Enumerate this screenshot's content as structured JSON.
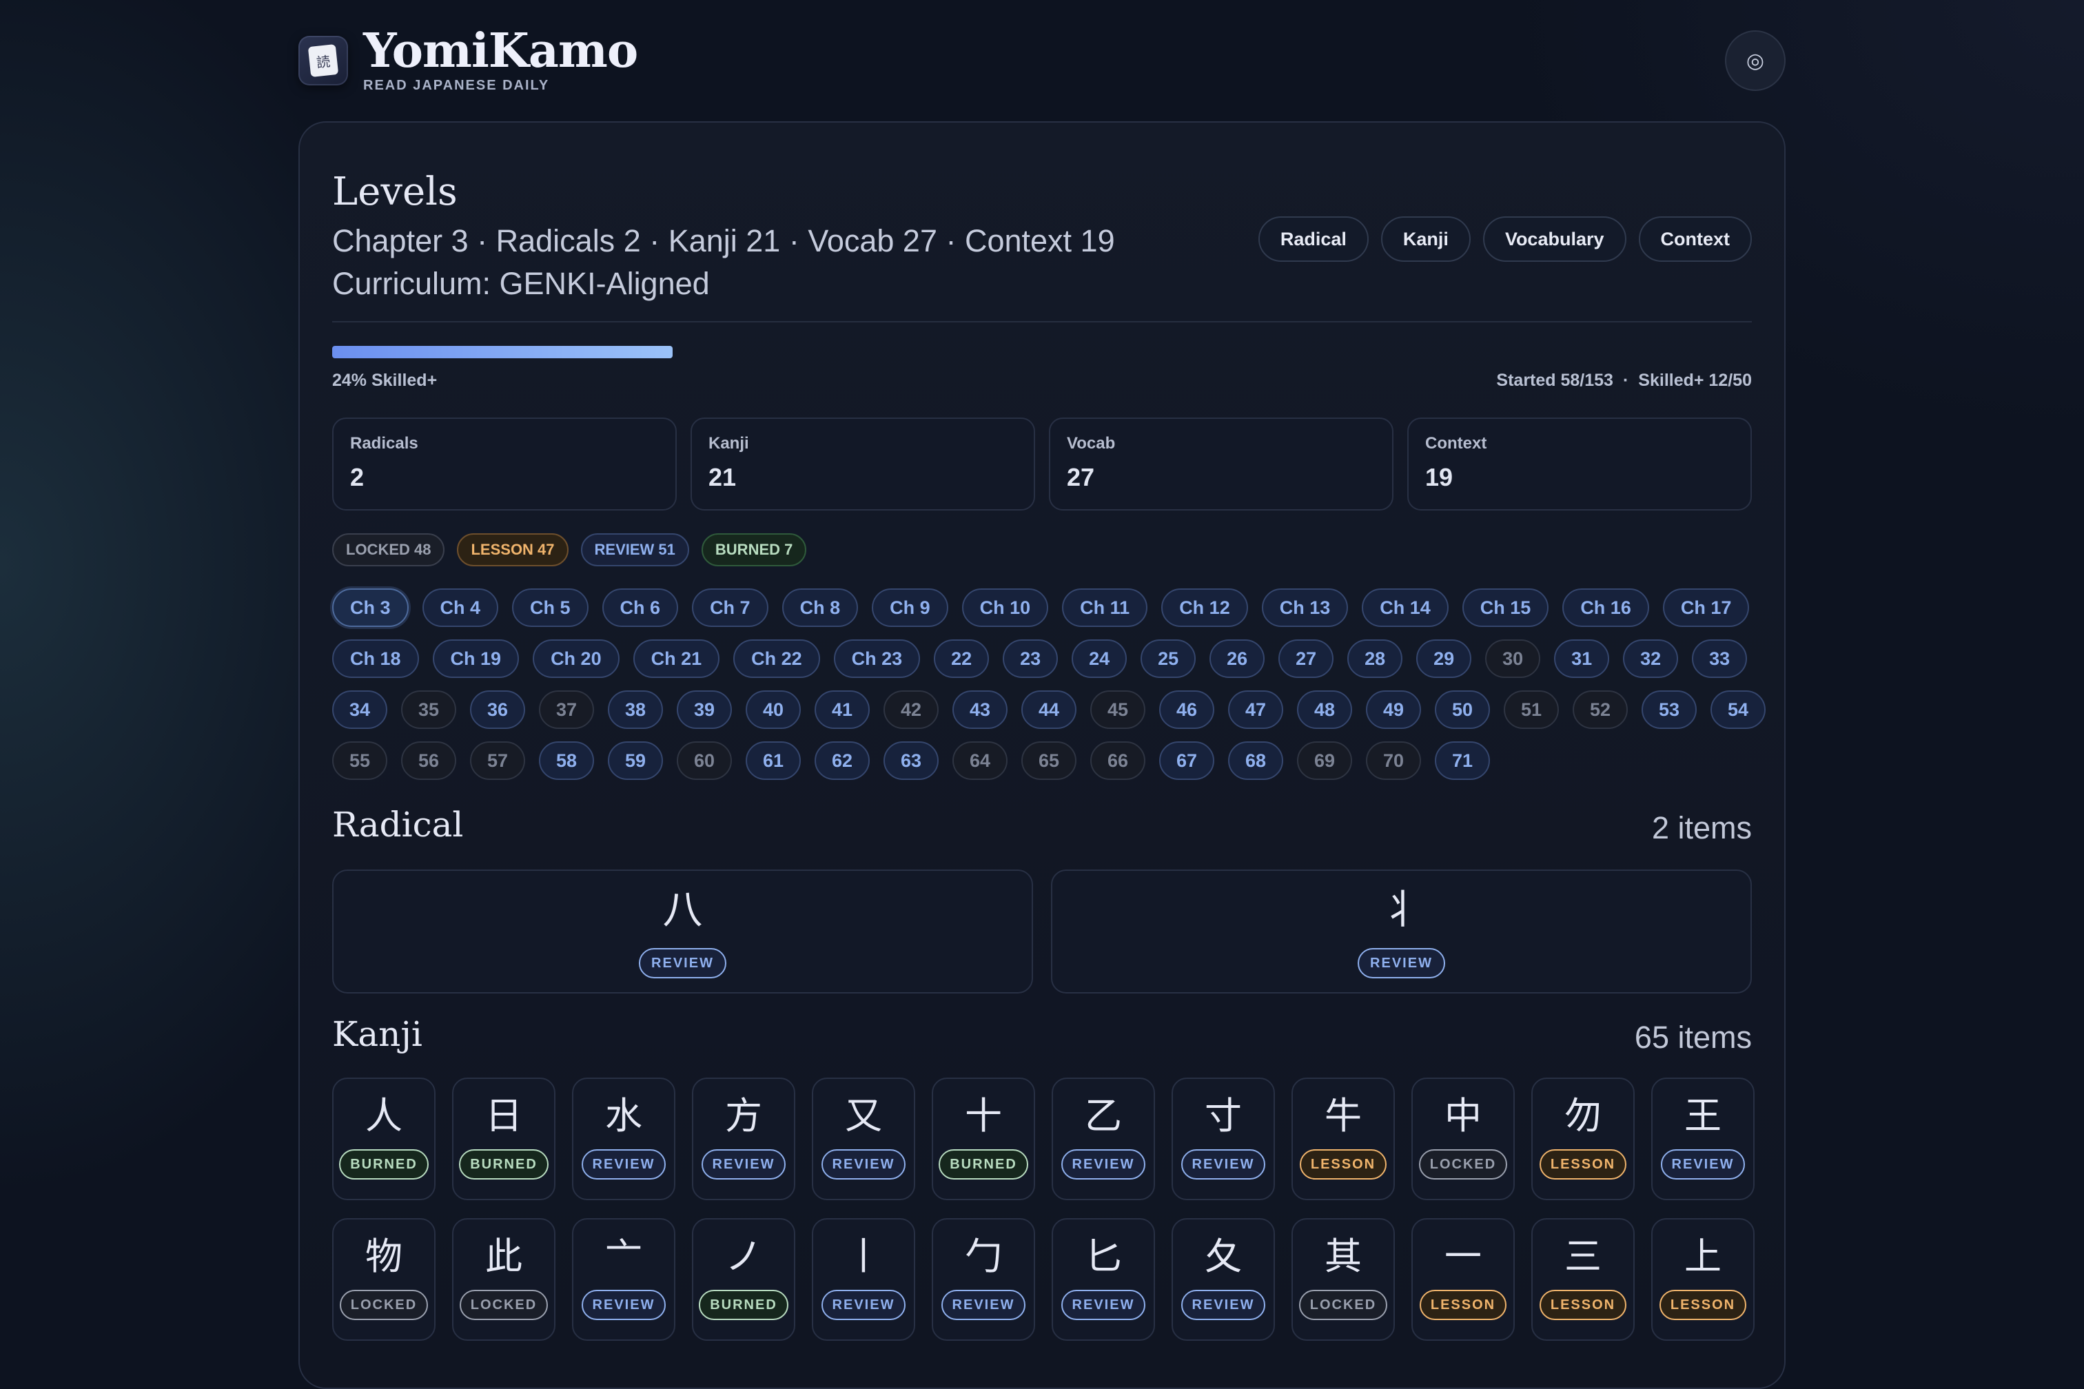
{
  "brand": {
    "title": "YomiKamo",
    "subtitle": "READ JAPANESE DAILY",
    "logo_glyph": "読"
  },
  "settings": {
    "icon": "target-icon",
    "glyph": "◎"
  },
  "levels": {
    "title": "Levels",
    "summary": "Chapter 3 · Radicals 2 · Kanji 21 · Vocab 27 · Context 19",
    "curriculum": "Curriculum: GENKI-Aligned",
    "filters": [
      "Radical",
      "Kanji",
      "Vocabulary",
      "Context"
    ],
    "progress": {
      "fraction": 0.24,
      "label": "24% Skilled+",
      "started": "Started 58/153",
      "separator": "·",
      "skilled": "Skilled+ 12/50"
    }
  },
  "stats": [
    {
      "label": "Radicals",
      "value": "2"
    },
    {
      "label": "Kanji",
      "value": "21"
    },
    {
      "label": "Vocab",
      "value": "27"
    },
    {
      "label": "Context",
      "value": "19"
    }
  ],
  "statuses": [
    {
      "label": "LOCKED 48",
      "kind": "locked"
    },
    {
      "label": "LESSON 47",
      "kind": "lesson"
    },
    {
      "label": "REVIEW 51",
      "kind": "review"
    },
    {
      "label": "BURNED 7",
      "kind": "burned"
    }
  ],
  "chapters": [
    {
      "label": "Ch 3",
      "state": "active"
    },
    {
      "label": "Ch 4"
    },
    {
      "label": "Ch 5"
    },
    {
      "label": "Ch 6"
    },
    {
      "label": "Ch 7"
    },
    {
      "label": "Ch 8"
    },
    {
      "label": "Ch 9"
    },
    {
      "label": "Ch 10"
    },
    {
      "label": "Ch 11"
    },
    {
      "label": "Ch 12"
    },
    {
      "label": "Ch 13"
    },
    {
      "label": "Ch 14"
    },
    {
      "label": "Ch 15"
    },
    {
      "label": "Ch 16"
    },
    {
      "label": "Ch 17"
    },
    {
      "label": "Ch 18"
    },
    {
      "label": "Ch 19"
    },
    {
      "label": "Ch 20"
    },
    {
      "label": "Ch 21"
    },
    {
      "label": "Ch 22"
    },
    {
      "label": "Ch 23"
    },
    {
      "label": "22",
      "num": true
    },
    {
      "label": "23",
      "num": true
    },
    {
      "label": "24",
      "num": true
    },
    {
      "label": "25",
      "num": true
    },
    {
      "label": "26",
      "num": true
    },
    {
      "label": "27",
      "num": true
    },
    {
      "label": "28",
      "num": true
    },
    {
      "label": "29",
      "num": true
    },
    {
      "label": "30",
      "num": true,
      "state": "empty"
    },
    {
      "label": "31",
      "num": true
    },
    {
      "label": "32",
      "num": true
    },
    {
      "label": "33",
      "num": true
    },
    {
      "label": "34",
      "num": true
    },
    {
      "label": "35",
      "num": true,
      "state": "empty"
    },
    {
      "label": "36",
      "num": true
    },
    {
      "label": "37",
      "num": true,
      "state": "empty"
    },
    {
      "label": "38",
      "num": true
    },
    {
      "label": "39",
      "num": true
    },
    {
      "label": "40",
      "num": true
    },
    {
      "label": "41",
      "num": true
    },
    {
      "label": "42",
      "num": true,
      "state": "empty"
    },
    {
      "label": "43",
      "num": true
    },
    {
      "label": "44",
      "num": true
    },
    {
      "label": "45",
      "num": true,
      "state": "empty"
    },
    {
      "label": "46",
      "num": true
    },
    {
      "label": "47",
      "num": true
    },
    {
      "label": "48",
      "num": true
    },
    {
      "label": "49",
      "num": true
    },
    {
      "label": "50",
      "num": true
    },
    {
      "label": "51",
      "num": true,
      "state": "empty"
    },
    {
      "label": "52",
      "num": true,
      "state": "empty"
    },
    {
      "label": "53",
      "num": true
    },
    {
      "label": "54",
      "num": true
    },
    {
      "label": "55",
      "num": true,
      "state": "empty"
    },
    {
      "label": "56",
      "num": true,
      "state": "empty"
    },
    {
      "label": "57",
      "num": true,
      "state": "empty"
    },
    {
      "label": "58",
      "num": true
    },
    {
      "label": "59",
      "num": true
    },
    {
      "label": "60",
      "num": true,
      "state": "empty"
    },
    {
      "label": "61",
      "num": true
    },
    {
      "label": "62",
      "num": true
    },
    {
      "label": "63",
      "num": true
    },
    {
      "label": "64",
      "num": true,
      "state": "empty"
    },
    {
      "label": "65",
      "num": true,
      "state": "empty"
    },
    {
      "label": "66",
      "num": true,
      "state": "empty"
    },
    {
      "label": "67",
      "num": true
    },
    {
      "label": "68",
      "num": true
    },
    {
      "label": "69",
      "num": true,
      "state": "empty"
    },
    {
      "label": "70",
      "num": true,
      "state": "empty"
    },
    {
      "label": "71",
      "num": true
    }
  ],
  "radical_section": {
    "title": "Radical",
    "count": "2 items"
  },
  "radicals": [
    {
      "glyph": "八",
      "status": "REVIEW",
      "kind": "review"
    },
    {
      "glyph": "丬",
      "status": "REVIEW",
      "kind": "review"
    }
  ],
  "kanji_section": {
    "title": "Kanji",
    "count": "65 items"
  },
  "kanji": [
    {
      "glyph": "人",
      "status": "BURNED",
      "kind": "burned"
    },
    {
      "glyph": "日",
      "status": "BURNED",
      "kind": "burned"
    },
    {
      "glyph": "水",
      "status": "REVIEW",
      "kind": "review"
    },
    {
      "glyph": "方",
      "status": "REVIEW",
      "kind": "review"
    },
    {
      "glyph": "又",
      "status": "REVIEW",
      "kind": "review"
    },
    {
      "glyph": "十",
      "status": "BURNED",
      "kind": "burned"
    },
    {
      "glyph": "乙",
      "status": "REVIEW",
      "kind": "review"
    },
    {
      "glyph": "寸",
      "status": "REVIEW",
      "kind": "review"
    },
    {
      "glyph": "牛",
      "status": "LESSON",
      "kind": "lesson"
    },
    {
      "glyph": "中",
      "status": "LOCKED",
      "kind": "locked"
    },
    {
      "glyph": "勿",
      "status": "LESSON",
      "kind": "lesson"
    },
    {
      "glyph": "王",
      "status": "REVIEW",
      "kind": "review"
    },
    {
      "glyph": "物",
      "status": "LOCKED",
      "kind": "locked"
    },
    {
      "glyph": "此",
      "status": "LOCKED",
      "kind": "locked"
    },
    {
      "glyph": "亠",
      "status": "REVIEW",
      "kind": "review"
    },
    {
      "glyph": "ノ",
      "status": "BURNED",
      "kind": "burned"
    },
    {
      "glyph": "丨",
      "status": "REVIEW",
      "kind": "review"
    },
    {
      "glyph": "勹",
      "status": "REVIEW",
      "kind": "review"
    },
    {
      "glyph": "匕",
      "status": "REVIEW",
      "kind": "review"
    },
    {
      "glyph": "夂",
      "status": "REVIEW",
      "kind": "review"
    },
    {
      "glyph": "其",
      "status": "LOCKED",
      "kind": "locked"
    },
    {
      "glyph": "一",
      "status": "LESSON",
      "kind": "lesson"
    },
    {
      "glyph": "三",
      "status": "LESSON",
      "kind": "lesson"
    },
    {
      "glyph": "上",
      "status": "LESSON",
      "kind": "lesson"
    }
  ]
}
